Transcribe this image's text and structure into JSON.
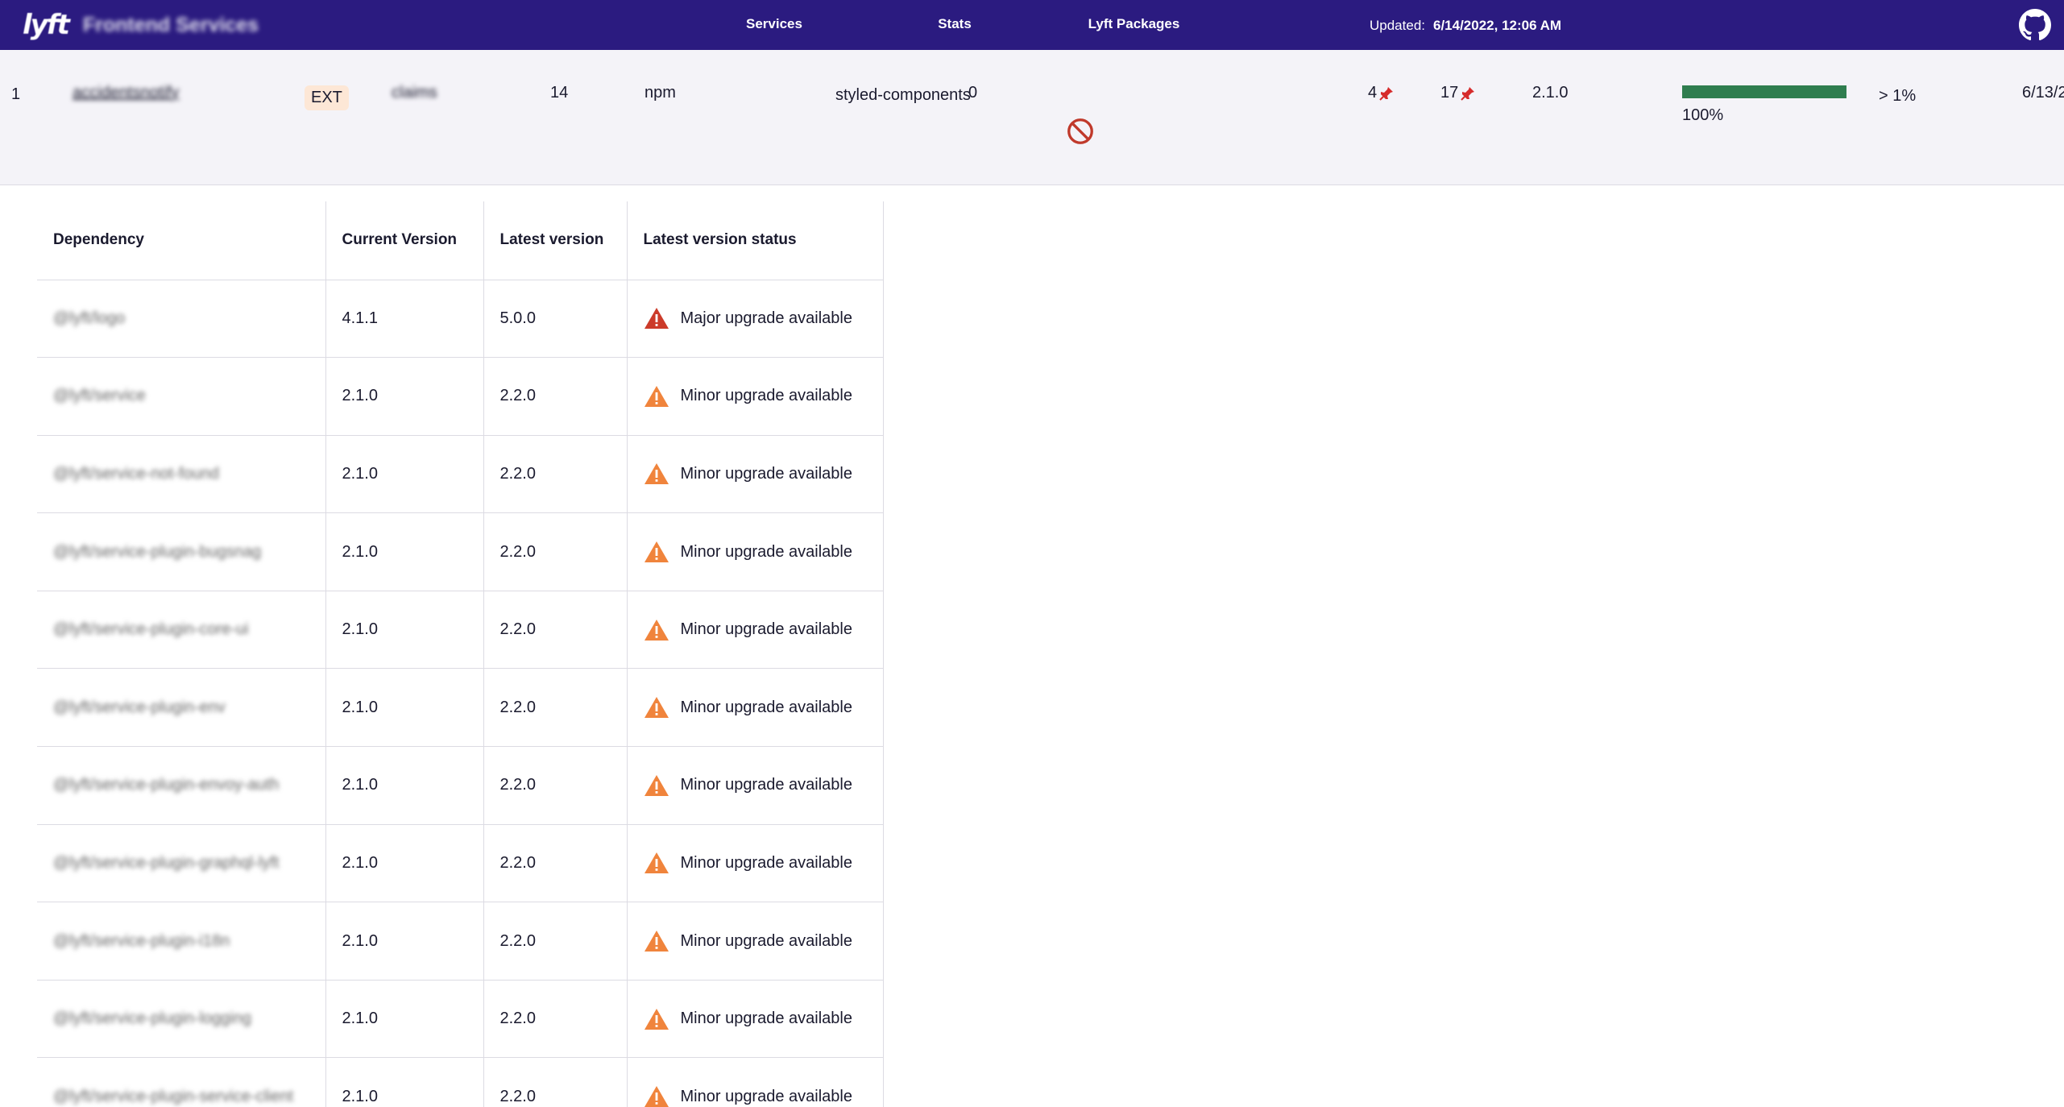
{
  "nav": {
    "brand_logo": "lyft",
    "brand_title": "Frontend Services",
    "tabs": [
      {
        "label": "Services",
        "active": true
      },
      {
        "label": "Stats",
        "active": false
      },
      {
        "label": "Lyft Packages",
        "active": false
      }
    ],
    "updated_label": "Updated:",
    "updated_value": "6/14/2022, 12:06 AM",
    "github_icon": "github-icon"
  },
  "service": {
    "index": "1",
    "name": "accidentsnotify",
    "badge": "EXT",
    "team": "claims",
    "count": "14",
    "package_manager": "npm",
    "framework": "styled-components",
    "zero_value": "0",
    "status_icon": "forbidden-icon",
    "pinned_a": "4",
    "pinned_b": "17",
    "pin_icon": "pin-icon",
    "version": "2.1.0",
    "progress_percent": 100,
    "progress_label": "100%",
    "share": "> 1%",
    "date": "6/13/2"
  },
  "table": {
    "headers": [
      "Dependency",
      "Current Version",
      "Latest version",
      "Latest version status"
    ],
    "rows": [
      {
        "dependency": "@lyft/logo",
        "current": "4.1.1",
        "latest": "5.0.0",
        "status": "Major upgrade available",
        "level": "major"
      },
      {
        "dependency": "@lyft/service",
        "current": "2.1.0",
        "latest": "2.2.0",
        "status": "Minor upgrade available",
        "level": "minor"
      },
      {
        "dependency": "@lyft/service-not-found",
        "current": "2.1.0",
        "latest": "2.2.0",
        "status": "Minor upgrade available",
        "level": "minor"
      },
      {
        "dependency": "@lyft/service-plugin-bugsnag",
        "current": "2.1.0",
        "latest": "2.2.0",
        "status": "Minor upgrade available",
        "level": "minor"
      },
      {
        "dependency": "@lyft/service-plugin-core-ui",
        "current": "2.1.0",
        "latest": "2.2.0",
        "status": "Minor upgrade available",
        "level": "minor"
      },
      {
        "dependency": "@lyft/service-plugin-env",
        "current": "2.1.0",
        "latest": "2.2.0",
        "status": "Minor upgrade available",
        "level": "minor"
      },
      {
        "dependency": "@lyft/service-plugin-envoy-auth",
        "current": "2.1.0",
        "latest": "2.2.0",
        "status": "Minor upgrade available",
        "level": "minor"
      },
      {
        "dependency": "@lyft/service-plugin-graphql-lyft",
        "current": "2.1.0",
        "latest": "2.2.0",
        "status": "Minor upgrade available",
        "level": "minor"
      },
      {
        "dependency": "@lyft/service-plugin-i18n",
        "current": "2.1.0",
        "latest": "2.2.0",
        "status": "Minor upgrade available",
        "level": "minor"
      },
      {
        "dependency": "@lyft/service-plugin-logging",
        "current": "2.1.0",
        "latest": "2.2.0",
        "status": "Minor upgrade available",
        "level": "minor"
      },
      {
        "dependency": "@lyft/service-plugin-service-client",
        "current": "2.1.0",
        "latest": "2.2.0",
        "status": "Minor upgrade available",
        "level": "minor"
      }
    ]
  },
  "colors": {
    "nav_bg": "#2b1b80",
    "major": "#cc3b2a",
    "minor": "#f0843c",
    "progress": "#2f7d4f",
    "forbidden": "#c0392b"
  }
}
